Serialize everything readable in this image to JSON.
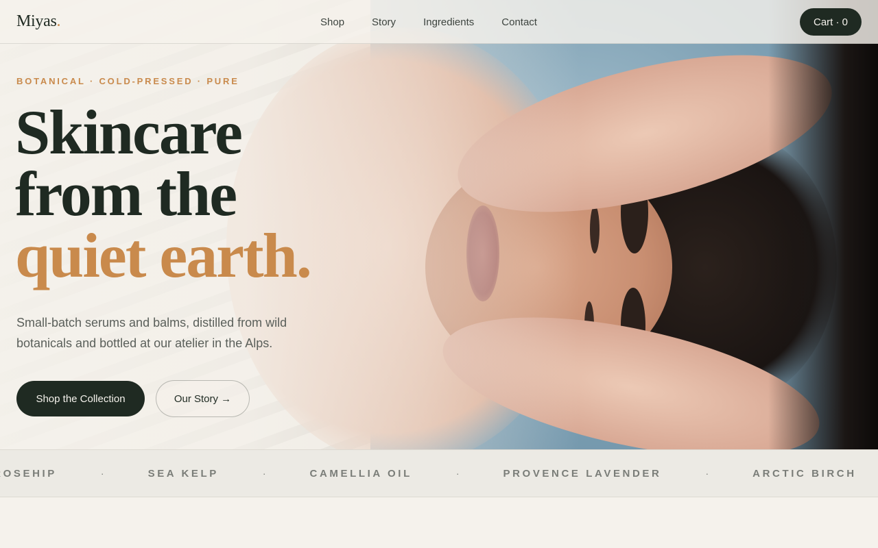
{
  "nav": {
    "logo": "Miyas",
    "logo_dot": ".",
    "links": [
      {
        "label": "Shop"
      },
      {
        "label": "Story"
      },
      {
        "label": "Ingredients"
      },
      {
        "label": "Contact"
      }
    ],
    "cart_label": "Cart · 0"
  },
  "hero": {
    "eyebrow": "BOTANICAL · COLD-PRESSED · PURE",
    "headline_line1": "Skincare",
    "headline_line2": "from the",
    "headline_accent": "quiet earth.",
    "lede": "Small-batch serums and balms, distilled from wild botanicals and bottled at our atelier in the Alps.",
    "primary_cta": "Shop the Collection",
    "secondary_cta": "Our Story →"
  },
  "marquee": {
    "items": [
      "D ROSEHIP",
      "SEA KELP",
      "CAMELLIA OIL",
      "PROVENCE LAVENDER",
      "ARCTIC BIRCH"
    ],
    "separator": "·"
  },
  "colors": {
    "brand_dark": "#1f2a22",
    "accent": "#c98a4c",
    "background": "#f5f2ec"
  }
}
